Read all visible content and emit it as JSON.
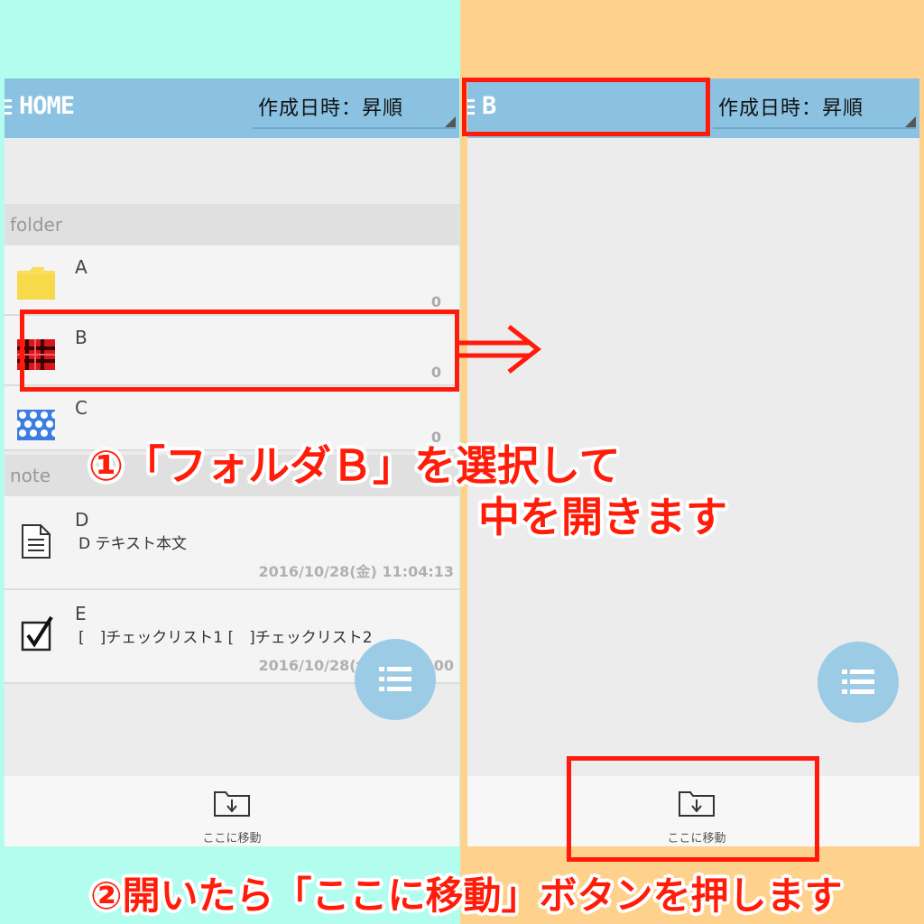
{
  "left_screen": {
    "appbar_title": "HOME",
    "sort_label": "作成日時：昇順",
    "folder_section": "folder",
    "note_section": "note",
    "folders": [
      {
        "name": "A",
        "count": "0",
        "icon": "folder-yellow-icon"
      },
      {
        "name": "B",
        "count": "0",
        "icon": "folder-red-plaid-icon"
      },
      {
        "name": "C",
        "count": "0",
        "icon": "folder-blue-polka-icon"
      }
    ],
    "notes": [
      {
        "title": "D",
        "preview": "D テキスト本文",
        "date": "2016/10/28(金) 11:04:13",
        "icon": "text-document-icon"
      },
      {
        "title": "E",
        "preview": "[　]チェックリスト1 [　]チェックリスト2",
        "date": "2016/10/28(金) 11:05:00",
        "icon": "checkbox-checked-icon"
      }
    ],
    "move_here_label": "ここに移動"
  },
  "right_screen": {
    "appbar_title": "B",
    "sort_label": "作成日時：昇順",
    "move_here_label": "ここに移動"
  },
  "captions": {
    "step1_line1": "①「フォルダＢ」を選択して",
    "step1_line2": "中を開きます",
    "step2": "②開いたら「ここに移動」ボタンを押します"
  },
  "colors": {
    "left_background": "#b3fdef",
    "right_background": "#fed28c",
    "appbar": "#8bc1e1",
    "fab": "#9ccbe6",
    "highlight_red": "#ff1a0b"
  }
}
